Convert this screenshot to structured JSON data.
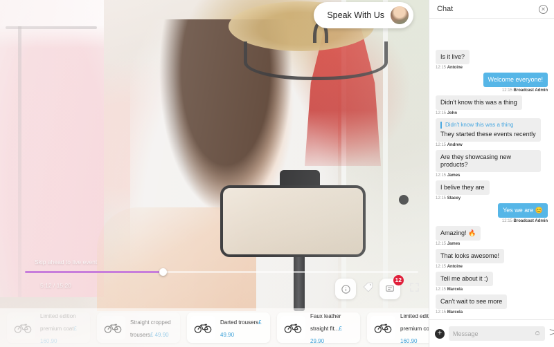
{
  "video": {
    "speak_button_label": "Speak With Us",
    "speak_avatar_icon": "avatar-icon",
    "skip_label": "Skip ahead to live event",
    "time_label": "5:12 / 15:20",
    "progress_percent": 35,
    "controls": {
      "info_icon": "info-icon",
      "tag_icon": "tag-icon",
      "chat_icon": "chat-icon",
      "fullscreen_icon": "fullscreen-icon",
      "chat_badge": "12"
    }
  },
  "carousel": {
    "products": [
      {
        "name": "Limited edition premium coat",
        "price": "£ 160.90",
        "thumb_icon": "bicycle-icon",
        "state": "ghost"
      },
      {
        "name": "Straight cropped trousers",
        "price": "£ 49.90",
        "thumb_icon": "bicycle-icon",
        "state": "faded"
      },
      {
        "name": "Darted trousers",
        "price": "£ 49.90",
        "thumb_icon": "bicycle-icon",
        "state": "normal"
      },
      {
        "name": "Faux leather straight fit...",
        "price": "£ 29.90",
        "thumb_icon": "bicycle-icon",
        "state": "normal"
      },
      {
        "name": "Limited edition premium coat",
        "price": "£ 160.90",
        "thumb_icon": "bicycle-icon",
        "state": "normal"
      },
      {
        "name": "",
        "price": "",
        "thumb_icon": "bicycle-icon",
        "state": "faded"
      }
    ]
  },
  "chat": {
    "title": "Chat",
    "close_icon": "close-icon",
    "messages": [
      {
        "side": "them",
        "text": "Is it live?",
        "time": "12:15",
        "author": "Antoine",
        "quote": ""
      },
      {
        "side": "me",
        "text": "Welcome everyone!",
        "time": "12:15",
        "author": "Broadcast Admin",
        "quote": ""
      },
      {
        "side": "them",
        "text": "Didn't know this was a thing",
        "time": "12:15",
        "author": "John",
        "quote": ""
      },
      {
        "side": "them",
        "text": "They started these events recently",
        "time": "12:15",
        "author": "Andrew",
        "quote": "Didn't know this was a thing"
      },
      {
        "side": "them",
        "text": "Are they showcasing new products?",
        "time": "12:15",
        "author": "James",
        "quote": ""
      },
      {
        "side": "them",
        "text": "I belive they are",
        "time": "12:15",
        "author": "Stacey",
        "quote": ""
      },
      {
        "side": "me",
        "text": "Yes we are 😊",
        "time": "12:15",
        "author": "Broadcast Admin",
        "quote": ""
      },
      {
        "side": "them",
        "text": "Amazing! 🔥",
        "time": "12:15",
        "author": "James",
        "quote": ""
      },
      {
        "side": "them",
        "text": "That looks awesome!",
        "time": "12:15",
        "author": "Antoine",
        "quote": ""
      },
      {
        "side": "them",
        "text": "Tell me about it :)",
        "time": "12:15",
        "author": "Marcela",
        "quote": ""
      },
      {
        "side": "them",
        "text": "Can't wait to see more",
        "time": "12:15",
        "author": "Marcela",
        "quote": ""
      }
    ],
    "composer": {
      "plus_icon": "plus-icon",
      "placeholder": "Message",
      "value": "",
      "emoji_icon": "emoji-icon",
      "send_icon": "send-icon"
    }
  },
  "colors": {
    "accent_blue": "#56b6e7",
    "price_blue": "#3aa0d8",
    "badge_red": "#e0203b",
    "scrub_purple": "#c77ddb"
  }
}
